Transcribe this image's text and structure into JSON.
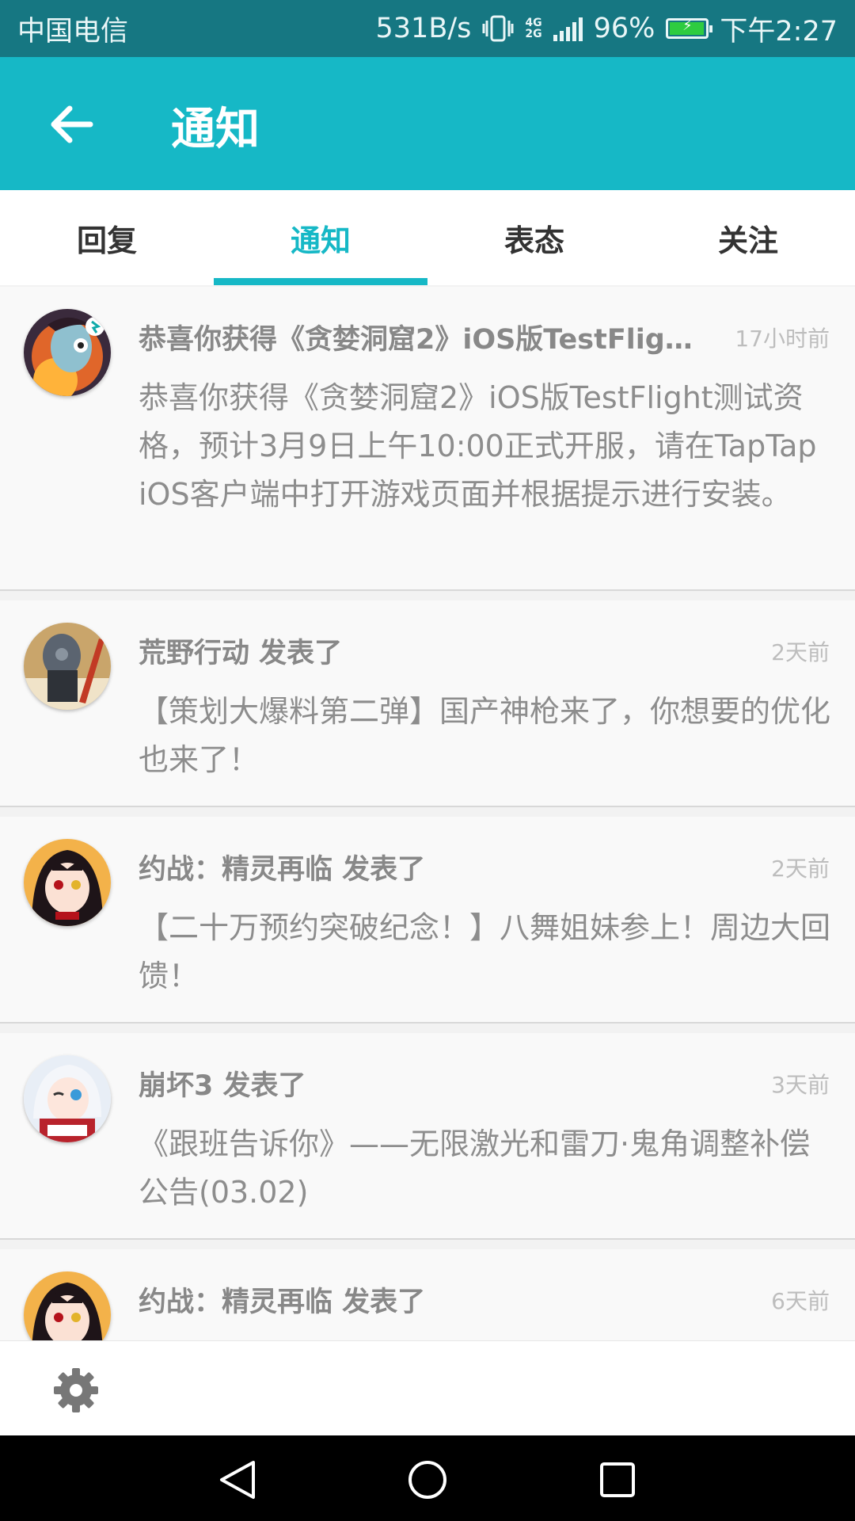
{
  "status_bar": {
    "carrier": "中国电信",
    "speed": "531B/s",
    "network_top": "4G",
    "network_bottom": "2G",
    "battery_percent": "96%",
    "battery_level": 0.96,
    "time": "下午2:27"
  },
  "app_bar": {
    "title": "通知"
  },
  "tabs": [
    {
      "label": "回复",
      "active": false
    },
    {
      "label": "通知",
      "active": true
    },
    {
      "label": "表态",
      "active": false
    },
    {
      "label": "关注",
      "active": false
    }
  ],
  "notifications": [
    {
      "title": "恭喜你获得《贪婪洞窟2》iOS版TestFlig...",
      "time": "17小时前",
      "body": "恭喜你获得《贪婪洞窟2》iOS版TestFlight测试资格，预计3月9日上午10:00正式开服，请在TapTap iOS客户端中打开游戏页面并根据提示进行安装。",
      "avatar_icon": "game-avatar-icon"
    },
    {
      "title": "荒野行动 发表了",
      "time": "2天前",
      "body": "【策划大爆料第二弹】国产神枪来了，你想要的优化也来了！",
      "avatar_icon": "game-avatar-icon"
    },
    {
      "title": "约战：精灵再临 发表了",
      "time": "2天前",
      "body": "【二十万预约突破纪念！】八舞姐妹参上！周边大回馈！",
      "avatar_icon": "game-avatar-icon"
    },
    {
      "title": "崩坏3 发表了",
      "time": "3天前",
      "body": "《跟班告诉你》——无限激光和雷刀·鬼角调整补偿公告(03.02)",
      "avatar_icon": "game-avatar-icon"
    },
    {
      "title": "约战：精灵再临 发表了",
      "time": "6天前",
      "body": "",
      "avatar_icon": "game-avatar-icon"
    }
  ],
  "colors": {
    "status_bar": "#167782",
    "accent": "#16b8c6",
    "title_text": "#888888",
    "body_text": "#8d8d8d",
    "time_text": "#bdbdbd"
  },
  "icons": {
    "back": "arrow-left-icon",
    "settings": "gear-icon",
    "nav_back": "triangle-back-icon",
    "nav_home": "circle-home-icon",
    "nav_recents": "square-recents-icon"
  }
}
